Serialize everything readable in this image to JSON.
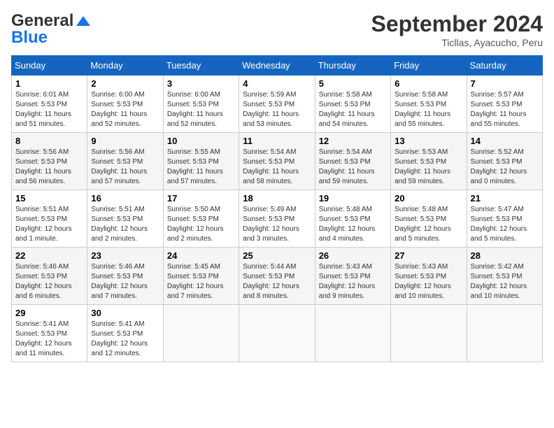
{
  "header": {
    "logo_line1": "General",
    "logo_line2": "Blue",
    "month": "September 2024",
    "location": "Ticllas, Ayacucho, Peru"
  },
  "weekdays": [
    "Sunday",
    "Monday",
    "Tuesday",
    "Wednesday",
    "Thursday",
    "Friday",
    "Saturday"
  ],
  "weeks": [
    [
      {
        "day": "1",
        "info": "Sunrise: 6:01 AM\nSunset: 5:53 PM\nDaylight: 11 hours\nand 51 minutes."
      },
      {
        "day": "2",
        "info": "Sunrise: 6:00 AM\nSunset: 5:53 PM\nDaylight: 11 hours\nand 52 minutes."
      },
      {
        "day": "3",
        "info": "Sunrise: 6:00 AM\nSunset: 5:53 PM\nDaylight: 11 hours\nand 52 minutes."
      },
      {
        "day": "4",
        "info": "Sunrise: 5:59 AM\nSunset: 5:53 PM\nDaylight: 11 hours\nand 53 minutes."
      },
      {
        "day": "5",
        "info": "Sunrise: 5:58 AM\nSunset: 5:53 PM\nDaylight: 11 hours\nand 54 minutes."
      },
      {
        "day": "6",
        "info": "Sunrise: 5:58 AM\nSunset: 5:53 PM\nDaylight: 11 hours\nand 55 minutes."
      },
      {
        "day": "7",
        "info": "Sunrise: 5:57 AM\nSunset: 5:53 PM\nDaylight: 11 hours\nand 55 minutes."
      }
    ],
    [
      {
        "day": "8",
        "info": "Sunrise: 5:56 AM\nSunset: 5:53 PM\nDaylight: 11 hours\nand 56 minutes."
      },
      {
        "day": "9",
        "info": "Sunrise: 5:56 AM\nSunset: 5:53 PM\nDaylight: 11 hours\nand 57 minutes."
      },
      {
        "day": "10",
        "info": "Sunrise: 5:55 AM\nSunset: 5:53 PM\nDaylight: 11 hours\nand 57 minutes."
      },
      {
        "day": "11",
        "info": "Sunrise: 5:54 AM\nSunset: 5:53 PM\nDaylight: 11 hours\nand 58 minutes."
      },
      {
        "day": "12",
        "info": "Sunrise: 5:54 AM\nSunset: 5:53 PM\nDaylight: 11 hours\nand 59 minutes."
      },
      {
        "day": "13",
        "info": "Sunrise: 5:53 AM\nSunset: 5:53 PM\nDaylight: 11 hours\nand 59 minutes."
      },
      {
        "day": "14",
        "info": "Sunrise: 5:52 AM\nSunset: 5:53 PM\nDaylight: 12 hours\nand 0 minutes."
      }
    ],
    [
      {
        "day": "15",
        "info": "Sunrise: 5:51 AM\nSunset: 5:53 PM\nDaylight: 12 hours\nand 1 minute."
      },
      {
        "day": "16",
        "info": "Sunrise: 5:51 AM\nSunset: 5:53 PM\nDaylight: 12 hours\nand 2 minutes."
      },
      {
        "day": "17",
        "info": "Sunrise: 5:50 AM\nSunset: 5:53 PM\nDaylight: 12 hours\nand 2 minutes."
      },
      {
        "day": "18",
        "info": "Sunrise: 5:49 AM\nSunset: 5:53 PM\nDaylight: 12 hours\nand 3 minutes."
      },
      {
        "day": "19",
        "info": "Sunrise: 5:48 AM\nSunset: 5:53 PM\nDaylight: 12 hours\nand 4 minutes."
      },
      {
        "day": "20",
        "info": "Sunrise: 5:48 AM\nSunset: 5:53 PM\nDaylight: 12 hours\nand 5 minutes."
      },
      {
        "day": "21",
        "info": "Sunrise: 5:47 AM\nSunset: 5:53 PM\nDaylight: 12 hours\nand 5 minutes."
      }
    ],
    [
      {
        "day": "22",
        "info": "Sunrise: 5:46 AM\nSunset: 5:53 PM\nDaylight: 12 hours\nand 6 minutes."
      },
      {
        "day": "23",
        "info": "Sunrise: 5:46 AM\nSunset: 5:53 PM\nDaylight: 12 hours\nand 7 minutes."
      },
      {
        "day": "24",
        "info": "Sunrise: 5:45 AM\nSunset: 5:53 PM\nDaylight: 12 hours\nand 7 minutes."
      },
      {
        "day": "25",
        "info": "Sunrise: 5:44 AM\nSunset: 5:53 PM\nDaylight: 12 hours\nand 8 minutes."
      },
      {
        "day": "26",
        "info": "Sunrise: 5:43 AM\nSunset: 5:53 PM\nDaylight: 12 hours\nand 9 minutes."
      },
      {
        "day": "27",
        "info": "Sunrise: 5:43 AM\nSunset: 5:53 PM\nDaylight: 12 hours\nand 10 minutes."
      },
      {
        "day": "28",
        "info": "Sunrise: 5:42 AM\nSunset: 5:53 PM\nDaylight: 12 hours\nand 10 minutes."
      }
    ],
    [
      {
        "day": "29",
        "info": "Sunrise: 5:41 AM\nSunset: 5:53 PM\nDaylight: 12 hours\nand 11 minutes."
      },
      {
        "day": "30",
        "info": "Sunrise: 5:41 AM\nSunset: 5:53 PM\nDaylight: 12 hours\nand 12 minutes."
      },
      {
        "day": "",
        "info": ""
      },
      {
        "day": "",
        "info": ""
      },
      {
        "day": "",
        "info": ""
      },
      {
        "day": "",
        "info": ""
      },
      {
        "day": "",
        "info": ""
      }
    ]
  ]
}
